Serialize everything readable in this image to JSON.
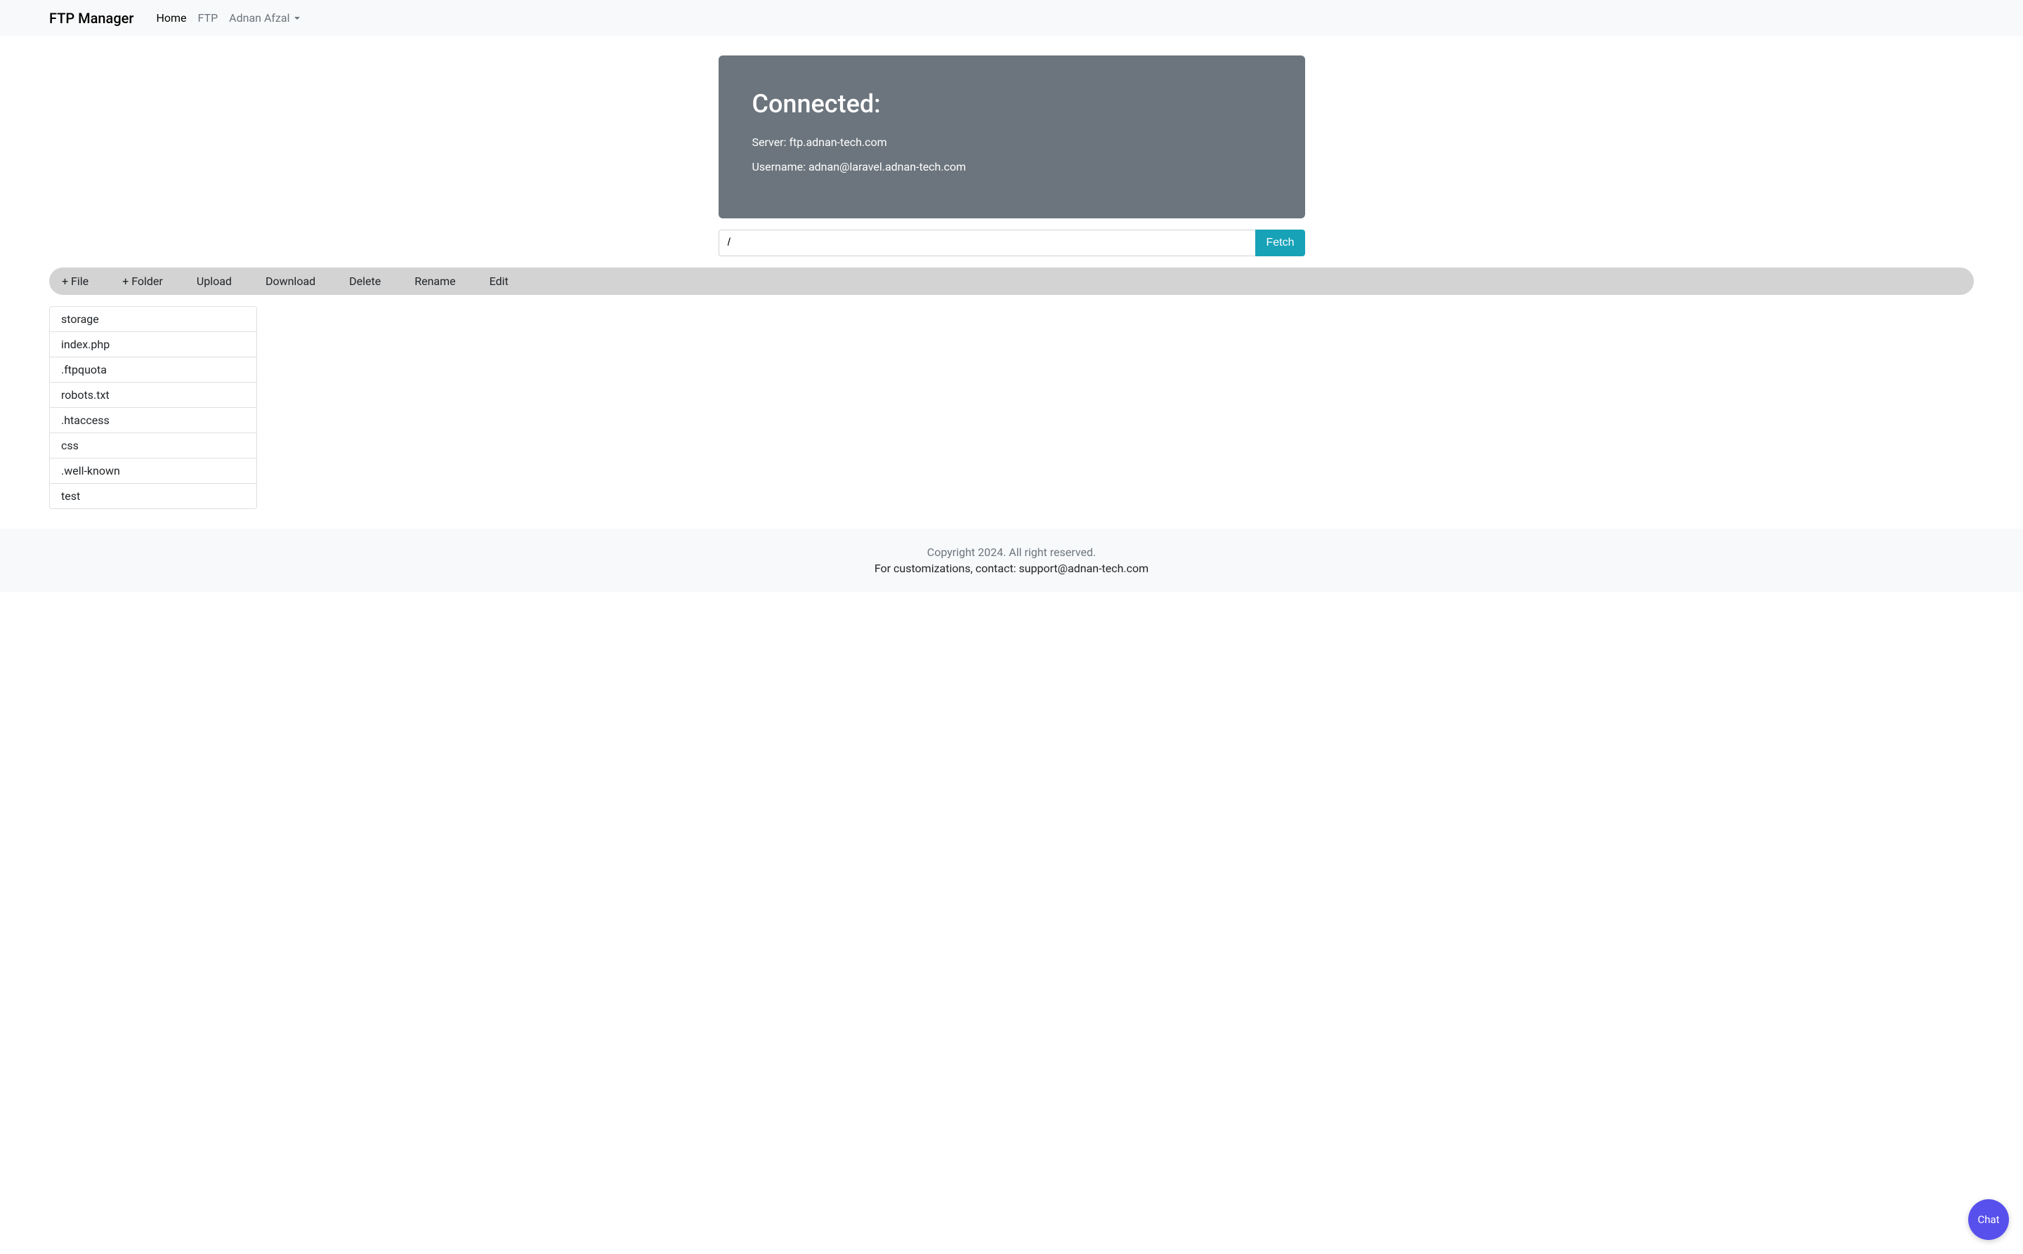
{
  "navbar": {
    "brand": "FTP Manager",
    "links": [
      {
        "label": "Home",
        "active": true
      },
      {
        "label": "FTP",
        "active": false
      }
    ],
    "dropdown": "Adnan Afzal"
  },
  "jumbotron": {
    "title": "Connected:",
    "server_label": "Server: ftp.adnan-tech.com",
    "username_label": "Username: adnan@laravel.adnan-tech.com"
  },
  "path": {
    "value": "/",
    "fetch_label": "Fetch"
  },
  "toolbar": {
    "new_file": "+ File",
    "new_folder": "+ Folder",
    "upload": "Upload",
    "download": "Download",
    "delete": "Delete",
    "rename": "Rename",
    "edit": "Edit"
  },
  "files": [
    "storage",
    "index.php",
    ".ftpquota",
    "robots.txt",
    ".htaccess",
    "css",
    ".well-known",
    "test"
  ],
  "footer": {
    "copyright": "Copyright 2024. All right reserved.",
    "contact": "For customizations, contact: support@adnan-tech.com"
  },
  "chat": {
    "label": "Chat"
  }
}
